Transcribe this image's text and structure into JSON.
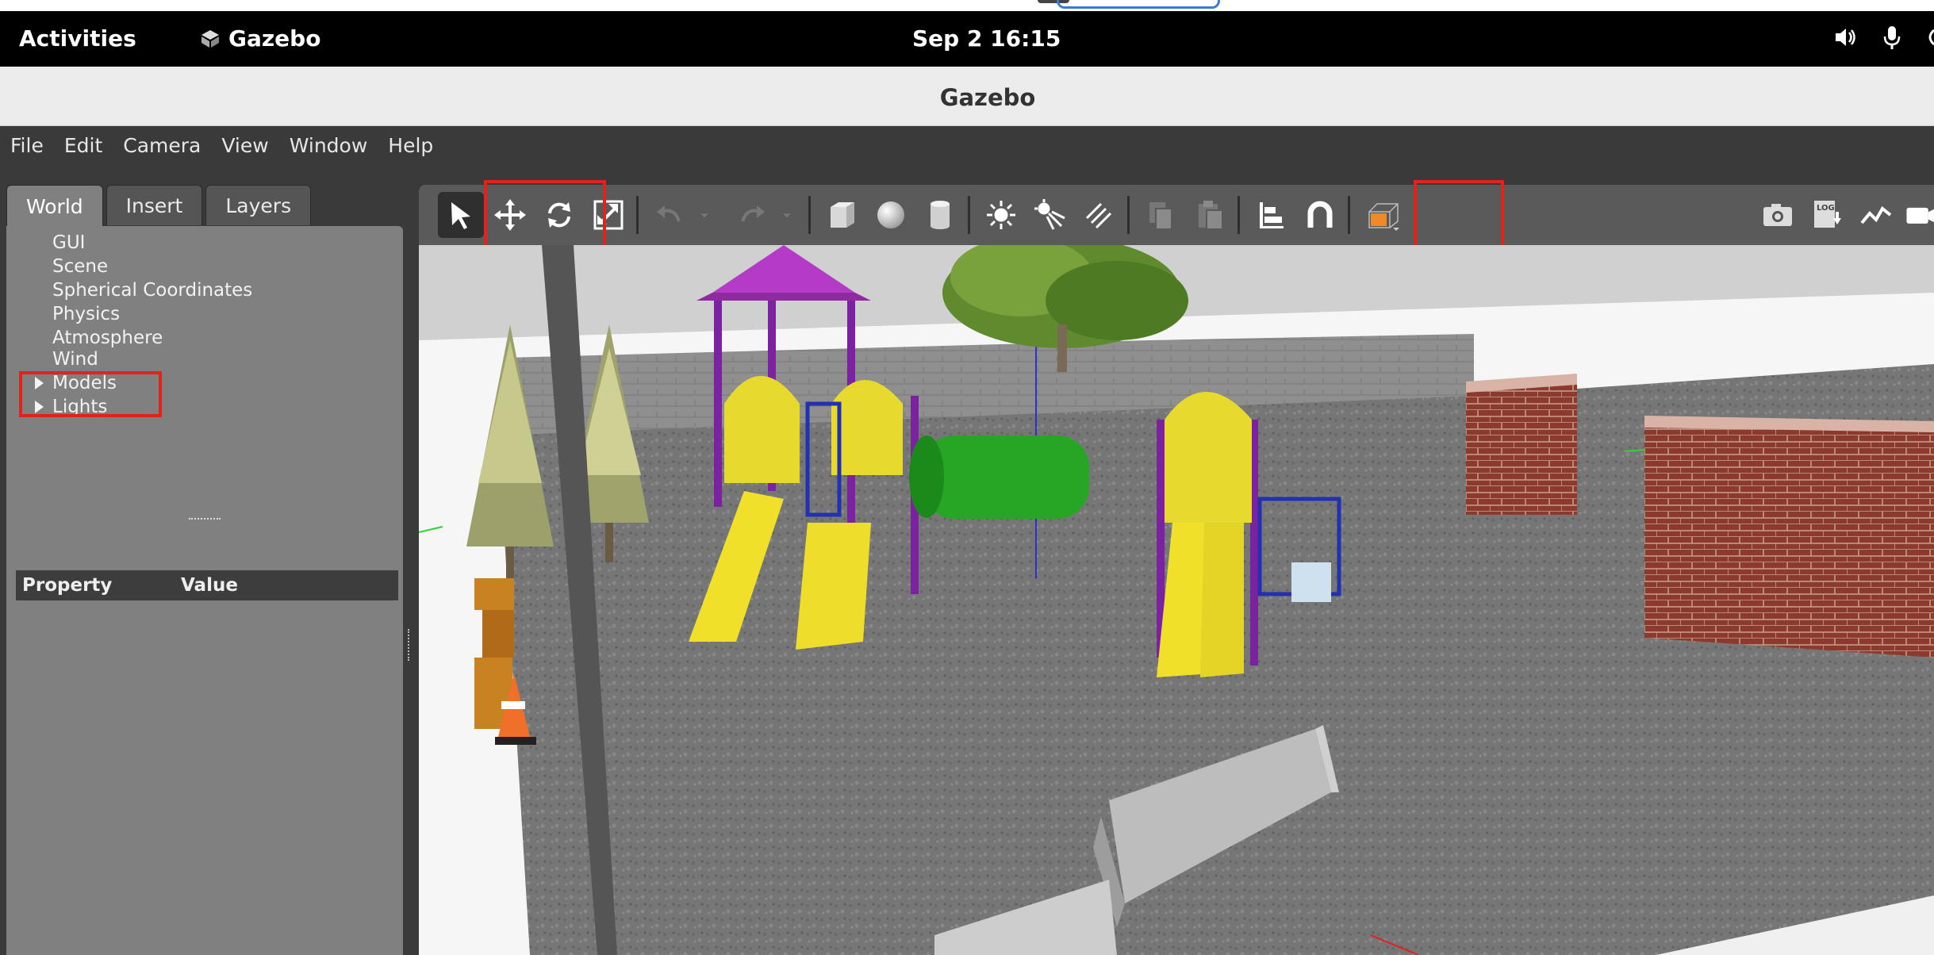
{
  "gnome": {
    "activities": "Activities",
    "app_name": "Gazebo",
    "clock": "Sep 2  16:15"
  },
  "window": {
    "title": "Gazebo"
  },
  "menu": [
    {
      "label": "File"
    },
    {
      "label": "Edit"
    },
    {
      "label": "Camera"
    },
    {
      "label": "View"
    },
    {
      "label": "Window"
    },
    {
      "label": "Help"
    }
  ],
  "left_panel": {
    "tabs": [
      {
        "label": "World",
        "active": true
      },
      {
        "label": "Insert",
        "active": false
      },
      {
        "label": "Layers",
        "active": false
      }
    ],
    "tree": [
      {
        "label": "GUI",
        "expandable": false
      },
      {
        "label": "Scene",
        "expandable": false
      },
      {
        "label": "Spherical Coordinates",
        "expandable": false
      },
      {
        "label": "Physics",
        "expandable": false
      },
      {
        "label": "Atmosphere",
        "expandable": false
      },
      {
        "label": "Wind",
        "expandable": false
      },
      {
        "label": "Models",
        "expandable": true
      },
      {
        "label": "Lights",
        "expandable": true
      }
    ],
    "property_header": {
      "property": "Property",
      "value": "Value"
    }
  },
  "toolbar": {
    "tools": [
      {
        "icon": "select-arrow-icon",
        "state": "selected"
      },
      {
        "icon": "translate-icon"
      },
      {
        "icon": "rotate-icon"
      },
      {
        "icon": "scale-icon"
      },
      {
        "icon": "undo-icon",
        "state": "disabled"
      },
      {
        "icon": "redo-icon",
        "state": "disabled"
      },
      {
        "icon": "box-shape-icon"
      },
      {
        "icon": "sphere-shape-icon"
      },
      {
        "icon": "cylinder-shape-icon"
      },
      {
        "icon": "point-light-icon"
      },
      {
        "icon": "spot-light-icon"
      },
      {
        "icon": "directional-light-icon"
      },
      {
        "icon": "copy-icon",
        "state": "disabled"
      },
      {
        "icon": "paste-icon",
        "state": "disabled"
      },
      {
        "icon": "align-icon"
      },
      {
        "icon": "snap-magnet-icon"
      },
      {
        "icon": "view-angle-cube-icon"
      }
    ],
    "right_tools": [
      {
        "icon": "screenshot-camera-icon"
      },
      {
        "icon": "log-icon",
        "label": "LOG"
      },
      {
        "icon": "plot-icon"
      },
      {
        "icon": "video-record-icon"
      }
    ]
  },
  "colors": {
    "highlight": "#e0241b",
    "panel_bg": "#808080",
    "menubar_bg": "#3a3a3a",
    "toolbar_bg": "#5a5a5a"
  }
}
